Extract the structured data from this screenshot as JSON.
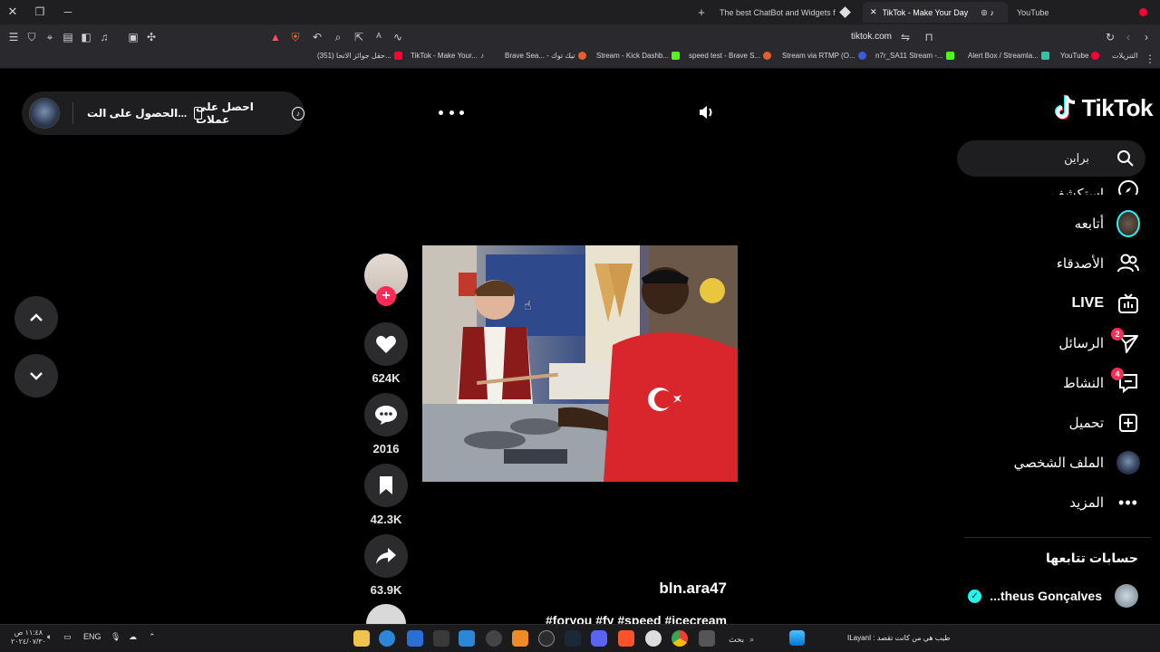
{
  "browser": {
    "tabs": [
      {
        "label": "The best ChatBot and Widgets for Ki"
      },
      {
        "label": "TikTok - Make Your Day"
      },
      {
        "label": "YouTube"
      }
    ],
    "url": "tiktok.com",
    "bookmarks": [
      {
        "label": "(351) حقل جوائز الاتحا...",
        "color": "#ff0033"
      },
      {
        "label": "TikTok - Make Your...",
        "color": "#ffffff"
      },
      {
        "label": "Brave Sea... - تيك توك",
        "color": "#e85d2b"
      },
      {
        "label": "Stream - Kick Dashb...",
        "color": "#53fc18"
      },
      {
        "label": "speed test - Brave S...",
        "color": "#e85d2b"
      },
      {
        "label": "Stream via RTMP (O...",
        "color": "#3a5bd9"
      },
      {
        "label": "n7r_SA11 Stream -...",
        "color": "#53fc18"
      },
      {
        "label": "Alert Box / Streamla...",
        "color": "#31c3a2"
      },
      {
        "label": "YouTube",
        "color": "#ff0033"
      },
      {
        "label": "التنزيلات",
        "color": "#cccccc"
      }
    ]
  },
  "tiktok": {
    "logo_text": "TikTok",
    "search_value": "براين",
    "get_coins_label": "احصل على عملات",
    "get_app_label": "الحصول على الت...",
    "nav": [
      {
        "label": "استكشف",
        "icon": "compass-icon"
      },
      {
        "label": "أتابعه",
        "icon": "following-avatar-icon"
      },
      {
        "label": "الأصدقاء",
        "icon": "friends-icon"
      },
      {
        "label": "LIVE",
        "icon": "live-icon"
      },
      {
        "label": "الرسائل",
        "icon": "messages-icon",
        "badge": "2"
      },
      {
        "label": "النشاط",
        "icon": "activity-icon",
        "badge": "4"
      },
      {
        "label": "تحميل",
        "icon": "upload-icon"
      },
      {
        "label": "الملف الشخصي",
        "icon": "profile-avatar-icon"
      },
      {
        "label": "المزيد",
        "icon": "more-icon"
      }
    ],
    "following_accounts_title": "حسابات تتابعها",
    "following_accounts": [
      {
        "name": "...theus Gonçalves",
        "live": true
      }
    ],
    "video": {
      "author": "bln.ara47",
      "caption": "#foryou #fy #speed #icecream",
      "likes": "624K",
      "comments": "2016",
      "saves": "42.3K",
      "shares": "63.9K"
    }
  },
  "taskbar": {
    "search_label": "بحث",
    "language": "ENG",
    "time": "١١:٤٨ ص",
    "date": "٢٠٢٤/٠٧/٣٠",
    "ticker": "طيب هي من كانت تقصد : ILayanI"
  },
  "colors": {
    "accent": "#fe2c55",
    "live_green": "#25f4ee"
  }
}
